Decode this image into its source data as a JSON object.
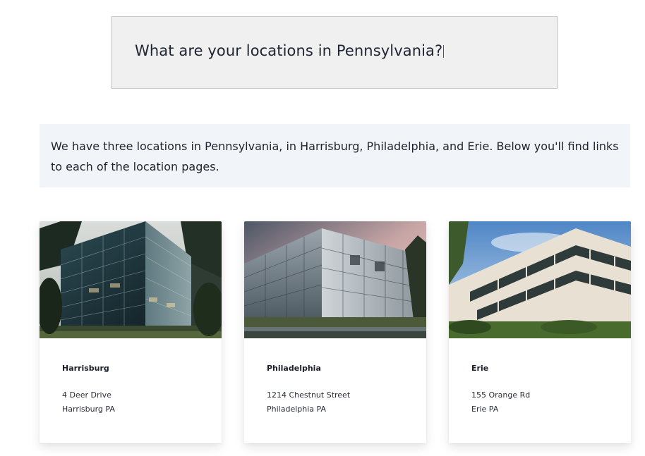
{
  "query": {
    "text": "What are your locations in Pennsylvania?"
  },
  "answer": {
    "text": "We have three locations in Pennsylvania, in Harrisburg, Philadelphia, and Erie. Below you'll find links to each of the location pages."
  },
  "locations": [
    {
      "name": "Harrisburg",
      "street": "4 Deer Drive",
      "city_state": "Harrisburg PA",
      "image": "glass-office-building-forest-photo"
    },
    {
      "name": "Philadelphia",
      "street": "1214 Chestnut Street",
      "city_state": "Philadelphia PA",
      "image": "glass-office-building-sunset-photo"
    },
    {
      "name": "Erie",
      "street": "155 Orange Rd",
      "city_state": "Erie PA",
      "image": "white-office-building-photo"
    }
  ],
  "colors": {
    "query_background": "#f0f0f0",
    "answer_background": "#f1f4f8",
    "text": "#1f2430"
  }
}
